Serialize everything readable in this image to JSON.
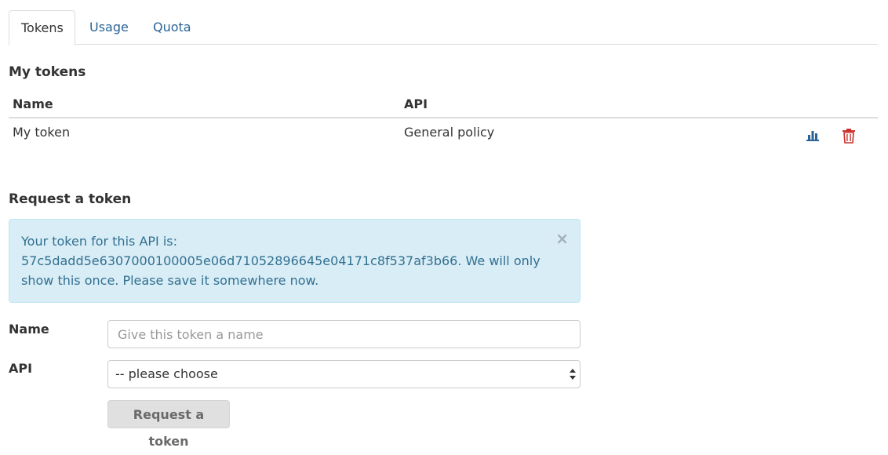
{
  "tabs": [
    {
      "label": "Tokens",
      "active": true
    },
    {
      "label": "Usage",
      "active": false
    },
    {
      "label": "Quota",
      "active": false
    }
  ],
  "my_tokens": {
    "heading": "My tokens",
    "columns": [
      "Name",
      "API"
    ],
    "rows": [
      {
        "name": "My token",
        "api": "General policy",
        "actions": [
          "stats-icon",
          "trash-icon"
        ]
      }
    ]
  },
  "request": {
    "heading": "Request a token",
    "alert": {
      "text": "Your token for this API is: 57c5dadd5e6307000100005e06d71052896645e04171c8f537af3b66. We will only show this once. Please save it somewhere now.",
      "close": "×"
    },
    "name_label": "Name",
    "name_placeholder": "Give this token a name",
    "name_value": "",
    "api_label": "API",
    "api_selected": "-- please choose",
    "submit_label": "Request a token"
  },
  "colors": {
    "link": "#2a6496",
    "alert_bg": "#d9edf7",
    "alert_text": "#31708f",
    "stats_icon": "#2a6496",
    "trash_icon": "#c9302c"
  }
}
